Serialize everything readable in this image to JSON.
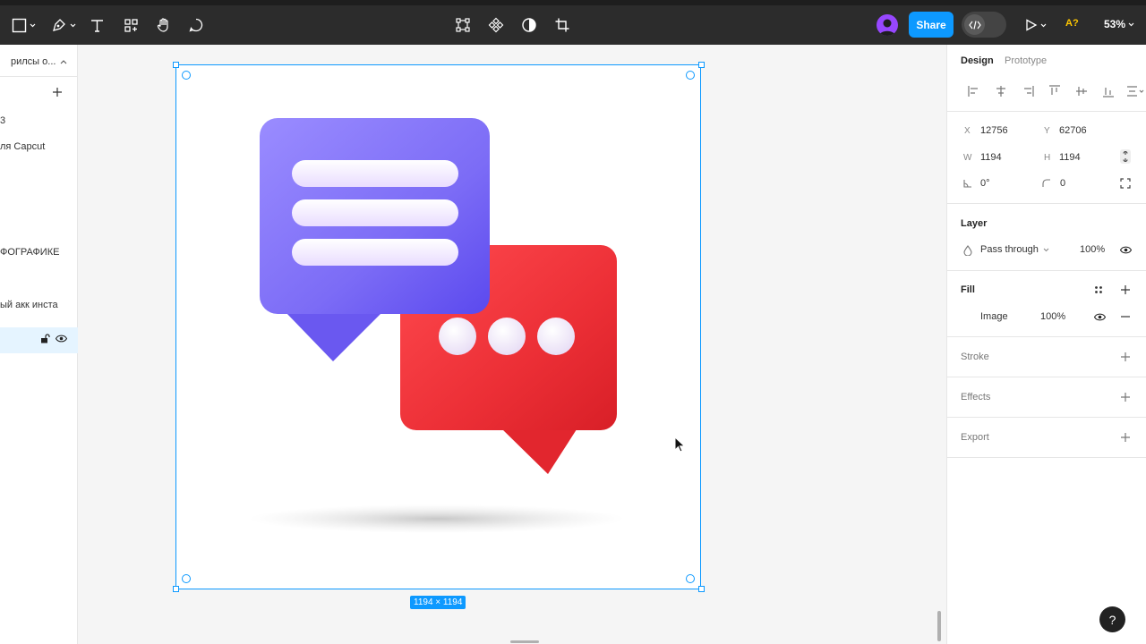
{
  "toolbar": {
    "share_label": "Share",
    "zoom_value": "53%",
    "missing_fonts_label": "A?"
  },
  "left_panel": {
    "pages_label": "рилсы о...",
    "items": [
      {
        "label": "3"
      },
      {
        "label": "ля Capcut"
      },
      {
        "label": "ФОГРАФИКЕ"
      },
      {
        "label": "ый акк инста"
      }
    ]
  },
  "canvas": {
    "frame_size_label": "1194 × 1194"
  },
  "right_panel": {
    "tabs": [
      {
        "label": "Design"
      },
      {
        "label": "Prototype"
      }
    ],
    "position": {
      "x_label": "X",
      "x_value": "12756",
      "y_label": "Y",
      "y_value": "62706",
      "w_label": "W",
      "w_value": "1194",
      "h_label": "H",
      "h_value": "1194",
      "rotation_value": "0°",
      "radius_value": "0"
    },
    "layer": {
      "title": "Layer",
      "blend_mode": "Pass through",
      "opacity": "100%"
    },
    "fill": {
      "title": "Fill",
      "type": "Image",
      "opacity": "100%"
    },
    "stroke": {
      "title": "Stroke"
    },
    "effects": {
      "title": "Effects"
    },
    "export": {
      "title": "Export"
    }
  },
  "help_label": "?",
  "colors": {
    "accent": "#0d99ff",
    "toolbar_bg": "#2c2c2c",
    "purple_bubble": "#7b68f5",
    "red_bubble": "#e8333a"
  }
}
